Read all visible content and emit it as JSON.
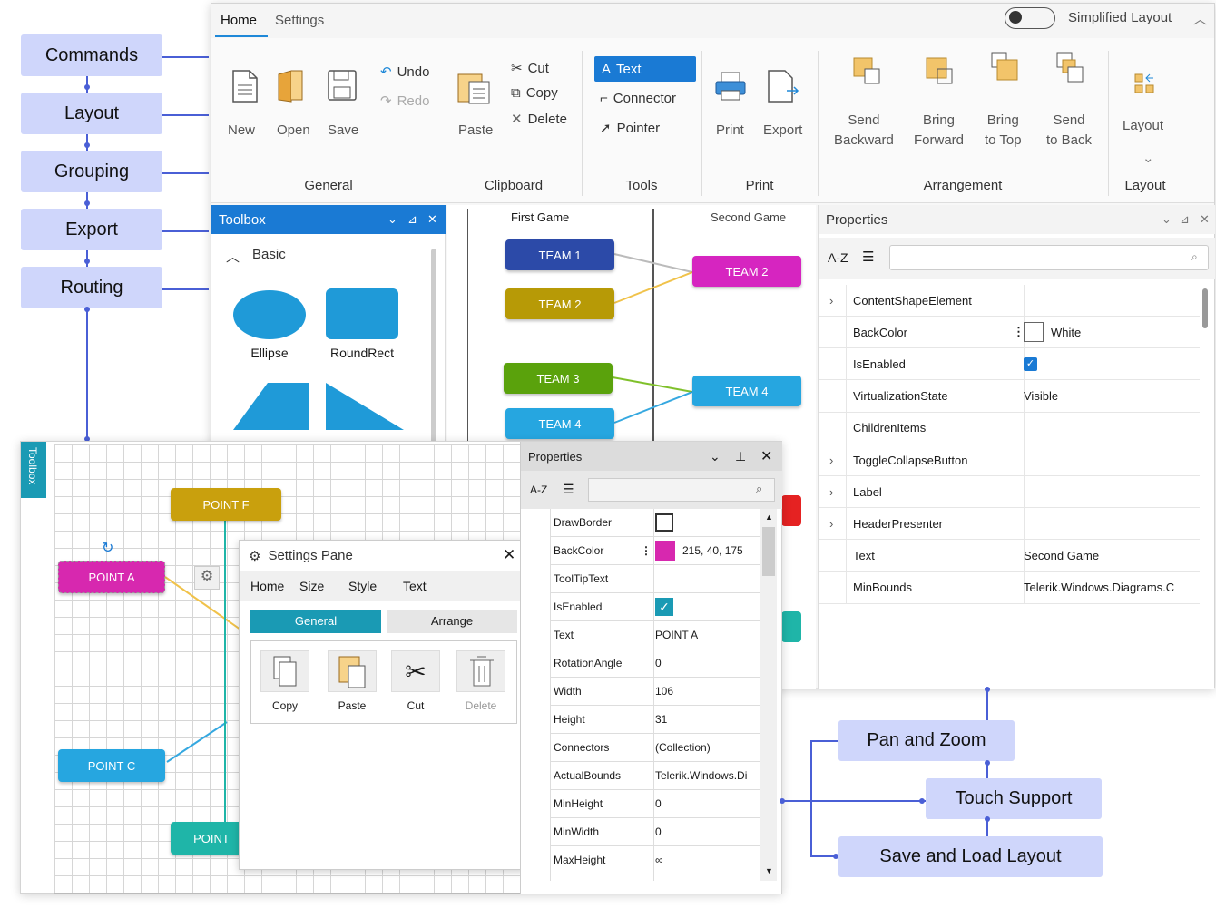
{
  "left_labels": [
    "Commands",
    "Layout",
    "Grouping",
    "Export",
    "Routing"
  ],
  "right_labels": [
    "Pan and Zoom",
    "Touch Support",
    "Save and Load Layout"
  ],
  "ribbon": {
    "tabs": [
      "Home",
      "Settings"
    ],
    "toggle_label": "Simplified Layout",
    "general": {
      "new": "New",
      "open": "Open",
      "save": "Save",
      "undo": "Undo",
      "redo": "Redo",
      "group": "General"
    },
    "clipboard": {
      "paste": "Paste",
      "cut": "Cut",
      "copy": "Copy",
      "delete": "Delete",
      "group": "Clipboard"
    },
    "tools": {
      "text": "Text",
      "connector": "Connector",
      "pointer": "Pointer",
      "group": "Tools"
    },
    "print": {
      "print": "Print",
      "export": "Export",
      "group": "Print"
    },
    "arrangement": {
      "send_backward": [
        "Send",
        "Backward"
      ],
      "bring_forward": [
        "Bring",
        "Forward"
      ],
      "bring_to_top": [
        "Bring",
        "to Top"
      ],
      "send_to_back": [
        "Send",
        "to Back"
      ],
      "group": "Arrangement"
    },
    "layout": {
      "button": "Layout",
      "group": "Layout"
    }
  },
  "toolbox": {
    "title": "Toolbox",
    "section": "Basic",
    "shapes": [
      "Ellipse",
      "RoundRect"
    ]
  },
  "diagram": {
    "col1": "First Game",
    "col2": "Second Game",
    "teams": [
      "TEAM 1",
      "TEAM 2",
      "TEAM 3",
      "TEAM 4",
      "TEAM 2",
      "TEAM 4"
    ]
  },
  "props_back": {
    "title": "Properties",
    "sort": "A-Z",
    "rows": [
      {
        "k": "ContentShapeElement",
        "v": "",
        "expand": true
      },
      {
        "k": "BackColor",
        "v": "White",
        "swatch": "#ffffff"
      },
      {
        "k": "IsEnabled",
        "v": "",
        "check": true
      },
      {
        "k": "VirtualizationState",
        "v": "Visible"
      },
      {
        "k": "ChildrenItems",
        "v": ""
      },
      {
        "k": "ToggleCollapseButton",
        "v": "",
        "expand": true
      },
      {
        "k": "Label",
        "v": "",
        "expand": true
      },
      {
        "k": "HeaderPresenter",
        "v": "",
        "expand": true
      },
      {
        "k": "Text",
        "v": "Second Game"
      },
      {
        "k": "MinBounds",
        "v": "Telerik.Windows.Diagrams.C"
      }
    ]
  },
  "front": {
    "toolbox_tab": "Toolbox",
    "points": [
      "POINT F",
      "POINT A",
      "POINT C",
      "POINT"
    ],
    "settings": {
      "title": "Settings Pane",
      "tabs": [
        "Home",
        "Size",
        "Style",
        "Text"
      ],
      "subtabs": [
        "General",
        "Arrange"
      ],
      "buttons": [
        "Copy",
        "Paste",
        "Cut",
        "Delete"
      ]
    },
    "props": {
      "title": "Properties",
      "sort": "A-Z",
      "rows": [
        {
          "k": "DrawBorder",
          "v": "",
          "box": true
        },
        {
          "k": "BackColor",
          "v": "215, 40, 175",
          "swatch": "#d728af"
        },
        {
          "k": "ToolTipText",
          "v": ""
        },
        {
          "k": "IsEnabled",
          "v": "",
          "check": true
        },
        {
          "k": "Text",
          "v": "POINT A"
        },
        {
          "k": "RotationAngle",
          "v": "0"
        },
        {
          "k": "Width",
          "v": "106"
        },
        {
          "k": "Height",
          "v": "31"
        },
        {
          "k": "Connectors",
          "v": "(Collection)"
        },
        {
          "k": "ActualBounds",
          "v": "Telerik.Windows.Di"
        },
        {
          "k": "MinHeight",
          "v": "0"
        },
        {
          "k": "MinWidth",
          "v": "0"
        },
        {
          "k": "MaxHeight",
          "v": "∞"
        }
      ]
    }
  }
}
